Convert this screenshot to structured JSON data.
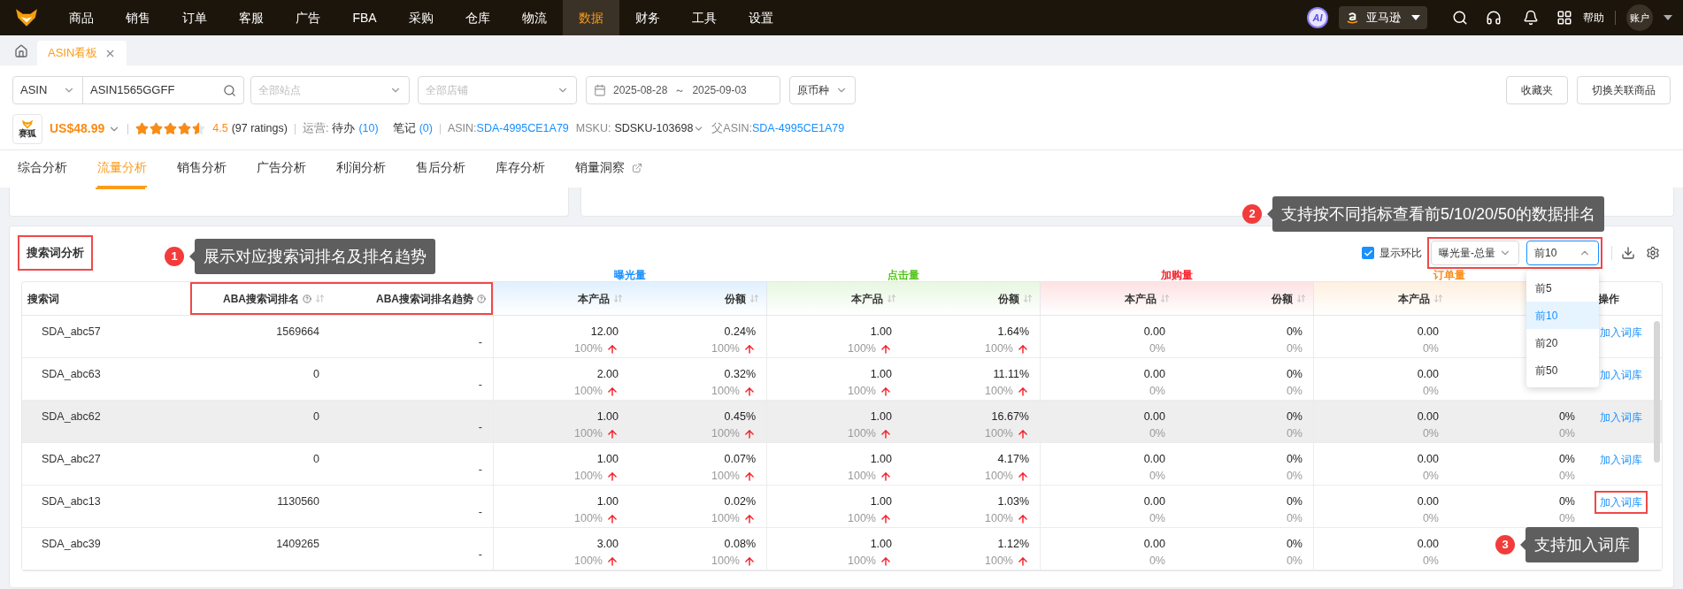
{
  "nav": {
    "items": [
      {
        "label": "商品",
        "selected": false
      },
      {
        "label": "销售",
        "selected": false
      },
      {
        "label": "订单",
        "selected": false
      },
      {
        "label": "客服",
        "selected": false
      },
      {
        "label": "广告",
        "selected": false
      },
      {
        "label": "FBA",
        "selected": false
      },
      {
        "label": "采购",
        "selected": false
      },
      {
        "label": "仓库",
        "selected": false
      },
      {
        "label": "物流",
        "selected": false
      },
      {
        "label": "数据",
        "selected": true
      },
      {
        "label": "财务",
        "selected": false
      },
      {
        "label": "工具",
        "selected": false
      },
      {
        "label": "设置",
        "selected": false
      }
    ],
    "ai": "AI",
    "marketplace": "亚马逊",
    "help": "帮助",
    "account": "账户"
  },
  "tabs": [
    {
      "label": "ASIN看板",
      "selected": true
    }
  ],
  "filters": {
    "type": "ASIN",
    "asin": "ASIN1565GGFF",
    "site_placeholder": "全部站点",
    "shop_placeholder": "全部店铺",
    "date_start": "2025-08-28",
    "date_sep": "～",
    "date_end": "2025-09-03",
    "currency": "原币种",
    "buttons": [
      "收藏夹",
      "切换关联商品"
    ]
  },
  "product": {
    "logo_text": "赛狐",
    "price": "US$48.99",
    "stars": 4.5,
    "rating": "4.5",
    "ratings_count": "(97 ratings)",
    "ops_label": "运营:",
    "todo_label": "待办",
    "todo_count": "(10)",
    "notes_label": "笔记",
    "notes_count": "(0)",
    "asin_label": "ASIN:",
    "asin": "SDA-4995CE1A79",
    "msku_label": "MSKU:",
    "msku": "SDSKU-103698",
    "parent_label": "父ASIN:",
    "parent_asin": "SDA-4995CE1A79"
  },
  "analysis_tabs": [
    {
      "label": "综合分析",
      "selected": false,
      "external": false
    },
    {
      "label": "流量分析",
      "selected": true,
      "external": false
    },
    {
      "label": "销售分析",
      "selected": false,
      "external": false
    },
    {
      "label": "广告分析",
      "selected": false,
      "external": false
    },
    {
      "label": "利润分析",
      "selected": false,
      "external": false
    },
    {
      "label": "售后分析",
      "selected": false,
      "external": false
    },
    {
      "label": "库存分析",
      "selected": false,
      "external": false
    },
    {
      "label": "销量洞察",
      "selected": false,
      "external": true
    }
  ],
  "search_terms": {
    "title": "搜索词分析",
    "title_highlighted": true,
    "compare": {
      "label": "显示环比",
      "checked": true
    },
    "metric_select": "曝光量-总量",
    "controls_highlighted": true,
    "top_select": {
      "value": "前10",
      "expanded": true,
      "options": [
        {
          "label": "前5",
          "selected": false
        },
        {
          "label": "前10",
          "selected": true
        },
        {
          "label": "前20",
          "selected": false
        },
        {
          "label": "前50",
          "selected": false
        }
      ]
    },
    "columns": {
      "term": "搜索词",
      "rank": "ABA搜索词排名",
      "trend": "ABA搜索词排名趋势",
      "aba_highlighted": true,
      "action": "操作"
    },
    "groups": [
      {
        "label": "曝光量",
        "color": "#1890ff",
        "columns": [
          "本产品",
          "份额"
        ]
      },
      {
        "label": "点击量",
        "color": "#52c41a",
        "columns": [
          "本产品",
          "份额"
        ]
      },
      {
        "label": "加购量",
        "color": "#f5222d",
        "columns": [
          "本产品",
          "份额"
        ]
      },
      {
        "label": "订单量",
        "color": "#fa8c16",
        "columns": [
          "本产品"
        ]
      }
    ],
    "rows": [
      {
        "term": "SDA_abc57",
        "rank": "1569664",
        "trend": "-",
        "hovered": false,
        "metrics": [
          {
            "value": "12.00",
            "change": "100%",
            "rising": true
          },
          {
            "value": "0.24%",
            "change": "100%",
            "rising": true
          },
          {
            "value": "1.00",
            "change": "100%",
            "rising": true
          },
          {
            "value": "1.64%",
            "change": "100%",
            "rising": true
          },
          {
            "value": "0.00",
            "change": "0%",
            "rising": false
          },
          {
            "value": "0%",
            "change": "0%",
            "rising": false
          },
          {
            "value": "0.00",
            "change": "0%",
            "rising": false
          }
        ],
        "action": "加入词库",
        "action_highlighted": false
      },
      {
        "term": "SDA_abc63",
        "rank": "0",
        "trend": "-",
        "hovered": false,
        "metrics": [
          {
            "value": "2.00",
            "change": "100%",
            "rising": true
          },
          {
            "value": "0.32%",
            "change": "100%",
            "rising": true
          },
          {
            "value": "1.00",
            "change": "100%",
            "rising": true
          },
          {
            "value": "11.11%",
            "change": "100%",
            "rising": true
          },
          {
            "value": "0.00",
            "change": "0%",
            "rising": false
          },
          {
            "value": "0%",
            "change": "0%",
            "rising": false
          },
          {
            "value": "0.00",
            "change": "0%",
            "rising": false
          }
        ],
        "action": "加入词库",
        "action_highlighted": false
      },
      {
        "term": "SDA_abc62",
        "rank": "0",
        "trend": "-",
        "hovered": true,
        "metrics": [
          {
            "value": "1.00",
            "change": "100%",
            "rising": true
          },
          {
            "value": "0.45%",
            "change": "100%",
            "rising": true
          },
          {
            "value": "1.00",
            "change": "100%",
            "rising": true
          },
          {
            "value": "16.67%",
            "change": "100%",
            "rising": true
          },
          {
            "value": "0.00",
            "change": "0%",
            "rising": false
          },
          {
            "value": "0%",
            "change": "0%",
            "rising": false
          },
          {
            "value": "0.00",
            "change": "0%",
            "rising": false
          },
          {
            "value": "0%",
            "change": "0%",
            "rising": false
          }
        ],
        "action": "加入词库",
        "action_highlighted": false
      },
      {
        "term": "SDA_abc27",
        "rank": "0",
        "trend": "-",
        "hovered": false,
        "metrics": [
          {
            "value": "1.00",
            "change": "100%",
            "rising": true
          },
          {
            "value": "0.07%",
            "change": "100%",
            "rising": true
          },
          {
            "value": "1.00",
            "change": "100%",
            "rising": true
          },
          {
            "value": "4.17%",
            "change": "100%",
            "rising": true
          },
          {
            "value": "0.00",
            "change": "0%",
            "rising": false
          },
          {
            "value": "0%",
            "change": "0%",
            "rising": false
          },
          {
            "value": "0.00",
            "change": "0%",
            "rising": false
          },
          {
            "value": "0%",
            "change": "0%",
            "rising": false
          }
        ],
        "action": "加入词库",
        "action_highlighted": false
      },
      {
        "term": "SDA_abc13",
        "rank": "1130560",
        "trend": "-",
        "hovered": false,
        "metrics": [
          {
            "value": "1.00",
            "change": "100%",
            "rising": true
          },
          {
            "value": "0.02%",
            "change": "100%",
            "rising": true
          },
          {
            "value": "1.00",
            "change": "100%",
            "rising": true
          },
          {
            "value": "1.03%",
            "change": "100%",
            "rising": true
          },
          {
            "value": "0.00",
            "change": "0%",
            "rising": false
          },
          {
            "value": "0%",
            "change": "0%",
            "rising": false
          },
          {
            "value": "0.00",
            "change": "0%",
            "rising": false
          },
          {
            "value": "0%",
            "change": "0%",
            "rising": false
          }
        ],
        "action": "加入词库",
        "action_highlighted": true
      },
      {
        "term": "SDA_abc39",
        "rank": "1409265",
        "trend": "-",
        "hovered": false,
        "metrics": [
          {
            "value": "3.00",
            "change": "100%",
            "rising": true
          },
          {
            "value": "0.08%",
            "change": "100%",
            "rising": true
          },
          {
            "value": "1.00",
            "change": "100%",
            "rising": true
          },
          {
            "value": "1.12%",
            "change": "100%",
            "rising": true
          },
          {
            "value": "0.00",
            "change": "0%",
            "rising": false
          },
          {
            "value": "0%",
            "change": "0%",
            "rising": false
          },
          {
            "value": "0.00",
            "change": "0%",
            "rising": false
          }
        ]
      }
    ]
  },
  "annotations": [
    {
      "number": "1",
      "text": "展示对应搜索词排名及排名趋势"
    },
    {
      "number": "2",
      "text": "支持按不同指标查看前5/10/20/50的数据排名"
    },
    {
      "number": "3",
      "text": "支持加入词库"
    }
  ]
}
